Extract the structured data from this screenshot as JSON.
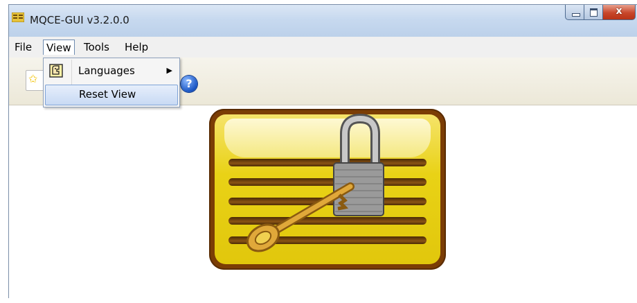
{
  "window": {
    "title": "MQCE-GUI v3.2.0.0",
    "close_glyph": "x"
  },
  "menubar": {
    "items": [
      "File",
      "View",
      "Tools",
      "Help"
    ],
    "active": "View"
  },
  "view_menu": {
    "items": [
      {
        "label": "Languages",
        "icon": "languages-icon",
        "has_submenu": true,
        "submenu_arrow": "▶"
      },
      {
        "label": "Reset View",
        "icon": "",
        "has_submenu": false
      }
    ],
    "highlighted": "Reset View"
  },
  "toolbar": {
    "buttons": [
      {
        "name": "new-icon",
        "glyph": "✩"
      },
      {
        "name": "help-icon",
        "glyph": "?"
      }
    ]
  },
  "colors": {
    "title_bar": "#c7d9ef",
    "close_button": "#c8472b",
    "logo_frame": "#7b3d05",
    "logo_fill": "#e9d216",
    "menu_highlight": "#c8daf4"
  }
}
